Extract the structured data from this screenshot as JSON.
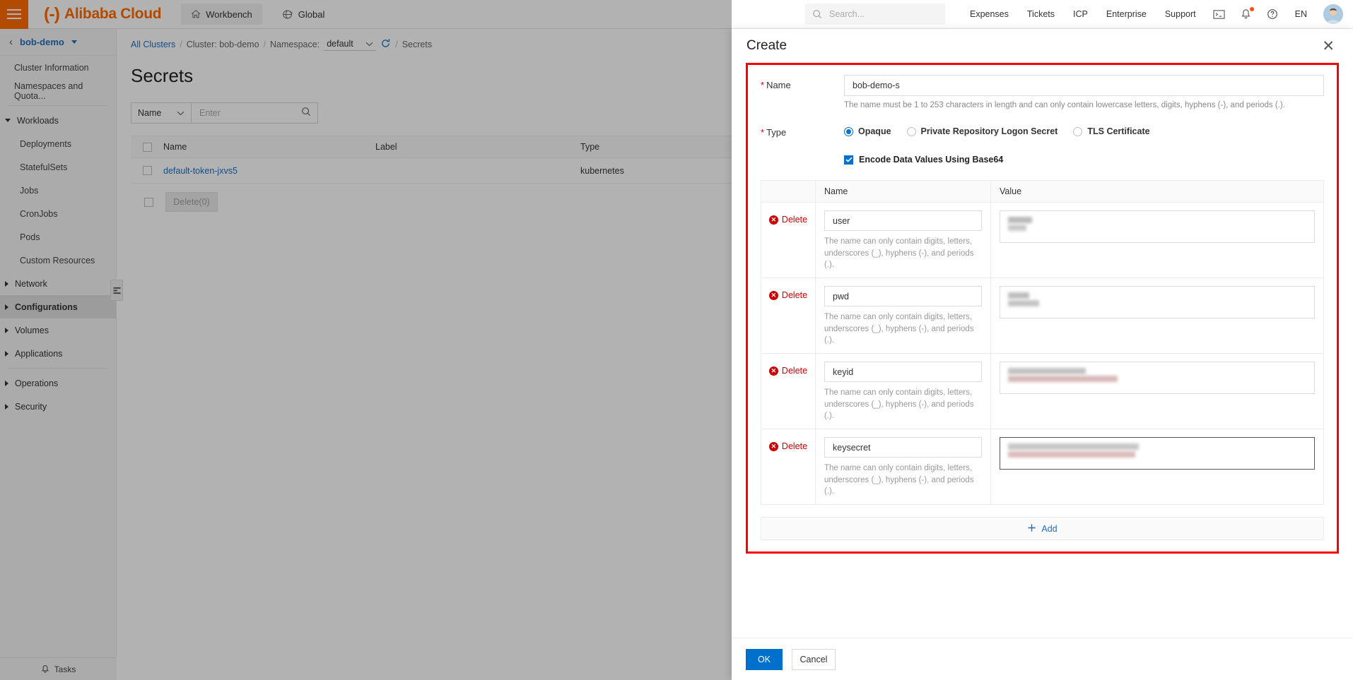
{
  "topnav": {
    "menu_icon": "hamburger-icon",
    "brand": "Alibaba Cloud",
    "workbench": "Workbench",
    "global": "Global",
    "search_placeholder": "Search...",
    "links": [
      "Expenses",
      "Tickets",
      "ICP",
      "Enterprise",
      "Support"
    ],
    "icons": [
      "console-icon",
      "bell-icon",
      "help-icon"
    ],
    "language": "EN",
    "accent_color": "#ff6a00"
  },
  "sidebar": {
    "cluster": "bob-demo",
    "top_items": [
      "Cluster Information",
      "Namespaces and Quota..."
    ],
    "groups": [
      {
        "label": "Workloads",
        "expanded": true,
        "children": [
          "Deployments",
          "StatefulSets",
          "Jobs",
          "CronJobs",
          "Pods",
          "Custom Resources"
        ]
      },
      {
        "label": "Network",
        "expanded": false,
        "children": []
      },
      {
        "label": "Configurations",
        "expanded": false,
        "active": true,
        "children": []
      },
      {
        "label": "Volumes",
        "expanded": false,
        "children": []
      },
      {
        "label": "Applications",
        "expanded": false,
        "children": []
      },
      {
        "label": "Operations",
        "expanded": false,
        "children": []
      },
      {
        "label": "Security",
        "expanded": false,
        "children": []
      }
    ],
    "footer": "Tasks"
  },
  "main": {
    "breadcrumb": {
      "all_clusters": "All Clusters",
      "cluster": "Cluster: bob-demo",
      "namespace_label": "Namespace:",
      "namespace_value": "default",
      "current": "Secrets",
      "separator": "/"
    },
    "page_title": "Secrets",
    "filter": {
      "field": "Name",
      "placeholder": "Enter",
      "value": ""
    },
    "table": {
      "columns": [
        "Name",
        "Label",
        "Type"
      ],
      "rows": [
        {
          "name": "default-token-jxvs5",
          "label": "",
          "type": "kubernetes"
        }
      ]
    },
    "bulk_delete": "Delete(0)"
  },
  "drawer": {
    "title": "Create",
    "close_icon": "close-icon",
    "name": {
      "label": "Name",
      "required": true,
      "value": "bob-demo-s",
      "helper": "The name must be 1 to 253 characters in length and can only contain lowercase letters, digits, hyphens (-), and periods (.)."
    },
    "type": {
      "label": "Type",
      "required": true,
      "options": [
        "Opaque",
        "Private Repository Logon Secret",
        "TLS Certificate"
      ],
      "selected": "Opaque"
    },
    "encode": {
      "label": "Encode Data Values Using Base64",
      "checked": true
    },
    "data_table": {
      "columns": [
        "Name",
        "Value"
      ],
      "delete_label": "Delete",
      "name_helper": "The name can only contain digits, letters, underscores (_), hyphens (-), and periods (.).",
      "rows": [
        {
          "name": "user",
          "value": "",
          "value_redacted": true,
          "redact_widths": [
            34,
            26
          ],
          "focused": false
        },
        {
          "name": "pwd",
          "value": "",
          "value_redacted": true,
          "redact_widths": [
            30,
            44
          ],
          "focused": false
        },
        {
          "name": "keyid",
          "value": "",
          "value_redacted": true,
          "redact_widths": [
            110,
            155
          ],
          "focused": false
        },
        {
          "name": "keysecret",
          "value": "",
          "value_redacted": true,
          "redact_widths": [
            185,
            180
          ],
          "focused": true
        }
      ]
    },
    "add_label": "Add",
    "add_icon": "plus-icon",
    "ok_label": "OK",
    "cancel_label": "Cancel",
    "highlight_color": "#ff0000",
    "primary_color": "#0070cc"
  }
}
